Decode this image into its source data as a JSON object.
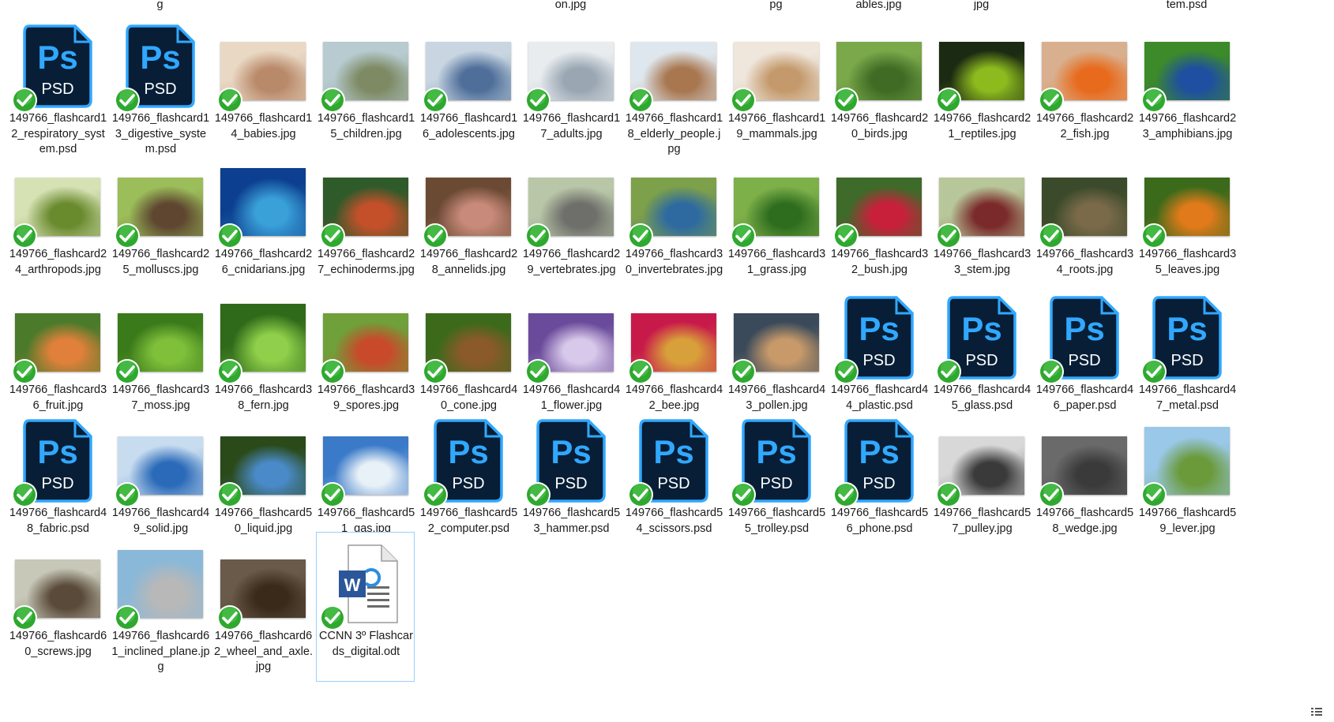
{
  "top_row_labels": [
    {
      "col": 1,
      "text": "g"
    },
    {
      "col": 5,
      "text": "on.jpg"
    },
    {
      "col": 7,
      "text": "pg"
    },
    {
      "col": 8,
      "text": "ables.jpg"
    },
    {
      "col": 9,
      "text": "jpg"
    },
    {
      "col": 11,
      "text": "tem.psd"
    }
  ],
  "files": [
    {
      "name": "149766_flashcard12_respiratory_system.psd",
      "type": "psd",
      "row": 0,
      "col": 0
    },
    {
      "name": "149766_flashcard13_digestive_system.psd",
      "type": "psd",
      "row": 0,
      "col": 1
    },
    {
      "name": "149766_flashcard14_babies.jpg",
      "type": "jpg",
      "row": 0,
      "col": 2,
      "colors": [
        "#e9d8c4",
        "#b98a6a"
      ]
    },
    {
      "name": "149766_flashcard15_children.jpg",
      "type": "jpg",
      "row": 0,
      "col": 3,
      "colors": [
        "#b7cbd0",
        "#7d8a63"
      ]
    },
    {
      "name": "149766_flashcard16_adolescents.jpg",
      "type": "jpg",
      "row": 0,
      "col": 4,
      "colors": [
        "#c9d6e2",
        "#4f6f9a"
      ]
    },
    {
      "name": "149766_flashcard17_adults.jpg",
      "type": "jpg",
      "row": 0,
      "col": 5,
      "colors": [
        "#e8ecef",
        "#9aa7b3"
      ]
    },
    {
      "name": "149766_flashcard18_elderly_people.jpg",
      "type": "jpg",
      "row": 0,
      "col": 6,
      "colors": [
        "#dfe7ee",
        "#a8764f"
      ]
    },
    {
      "name": "149766_flashcard19_mammals.jpg",
      "type": "jpg",
      "row": 0,
      "col": 7,
      "colors": [
        "#efe6dc",
        "#c49a6c"
      ]
    },
    {
      "name": "149766_flashcard20_birds.jpg",
      "type": "jpg",
      "row": 0,
      "col": 8,
      "colors": [
        "#7aa84a",
        "#3f6b24"
      ]
    },
    {
      "name": "149766_flashcard21_reptiles.jpg",
      "type": "jpg",
      "row": 0,
      "col": 9,
      "colors": [
        "#1b2a12",
        "#8dbb1e"
      ]
    },
    {
      "name": "149766_flashcard22_fish.jpg",
      "type": "jpg",
      "row": 0,
      "col": 10,
      "colors": [
        "#d9b08f",
        "#e86a1c"
      ]
    },
    {
      "name": "149766_flashcard23_amphibians.jpg",
      "type": "jpg",
      "row": 0,
      "col": 11,
      "colors": [
        "#3c8a2a",
        "#1f4fa0"
      ]
    },
    {
      "name": "149766_flashcard24_arthropods.jpg",
      "type": "jpg",
      "row": 1,
      "col": 0,
      "colors": [
        "#d6e2b4",
        "#6a8a2e"
      ]
    },
    {
      "name": "149766_flashcard25_molluscs.jpg",
      "type": "jpg",
      "row": 1,
      "col": 1,
      "colors": [
        "#9bbd5a",
        "#5e4630"
      ]
    },
    {
      "name": "149766_flashcard26_cnidarians.jpg",
      "type": "jpg",
      "row": 1,
      "col": 2,
      "colors": [
        "#0c3f8f",
        "#3aa0d8"
      ],
      "tall": true
    },
    {
      "name": "149766_flashcard27_echinoderms.jpg",
      "type": "jpg",
      "row": 1,
      "col": 3,
      "colors": [
        "#2f5a2a",
        "#c4502a"
      ]
    },
    {
      "name": "149766_flashcard28_annelids.jpg",
      "type": "jpg",
      "row": 1,
      "col": 4,
      "colors": [
        "#6b4a34",
        "#c88a7a"
      ]
    },
    {
      "name": "149766_flashcard29_vertebrates.jpg",
      "type": "jpg",
      "row": 1,
      "col": 5,
      "colors": [
        "#b9c7a8",
        "#6e6e6a"
      ]
    },
    {
      "name": "149766_flashcard30_invertebrates.jpg",
      "type": "jpg",
      "row": 1,
      "col": 6,
      "colors": [
        "#7da04a",
        "#2e6aa0"
      ]
    },
    {
      "name": "149766_flashcard31_grass.jpg",
      "type": "jpg",
      "row": 1,
      "col": 7,
      "colors": [
        "#7eb04a",
        "#2f6d1e"
      ]
    },
    {
      "name": "149766_flashcard32_bush.jpg",
      "type": "jpg",
      "row": 1,
      "col": 8,
      "colors": [
        "#3e6a2a",
        "#c8203a"
      ]
    },
    {
      "name": "149766_flashcard33_stem.jpg",
      "type": "jpg",
      "row": 1,
      "col": 9,
      "colors": [
        "#b8c79a",
        "#7a2a2a"
      ]
    },
    {
      "name": "149766_flashcard34_roots.jpg",
      "type": "jpg",
      "row": 1,
      "col": 10,
      "colors": [
        "#3a4a2a",
        "#7a6a4a"
      ]
    },
    {
      "name": "149766_flashcard35_leaves.jpg",
      "type": "jpg",
      "row": 1,
      "col": 11,
      "colors": [
        "#3a6a1a",
        "#e07a1a"
      ]
    },
    {
      "name": "149766_flashcard36_fruit.jpg",
      "type": "jpg",
      "row": 2,
      "col": 0,
      "colors": [
        "#4a7a2a",
        "#e0803a"
      ]
    },
    {
      "name": "149766_flashcard37_moss.jpg",
      "type": "jpg",
      "row": 2,
      "col": 1,
      "colors": [
        "#3a7a1a",
        "#7fbf3a"
      ]
    },
    {
      "name": "149766_flashcard38_fern.jpg",
      "type": "jpg",
      "row": 2,
      "col": 2,
      "colors": [
        "#2f6a1a",
        "#8fcf4a"
      ],
      "tall": true
    },
    {
      "name": "149766_flashcard39_spores.jpg",
      "type": "jpg",
      "row": 2,
      "col": 3,
      "colors": [
        "#6fa03a",
        "#c84a2a"
      ]
    },
    {
      "name": "149766_flashcard40_cone.jpg",
      "type": "jpg",
      "row": 2,
      "col": 4,
      "colors": [
        "#3a6a1a",
        "#8a5a2a"
      ]
    },
    {
      "name": "149766_flashcard41_flower.jpg",
      "type": "jpg",
      "row": 2,
      "col": 5,
      "colors": [
        "#6a4a9a",
        "#d8c8ea"
      ]
    },
    {
      "name": "149766_flashcard42_bee.jpg",
      "type": "jpg",
      "row": 2,
      "col": 6,
      "colors": [
        "#c81a4a",
        "#d8a03a"
      ]
    },
    {
      "name": "149766_flashcard43_pollen.jpg",
      "type": "jpg",
      "row": 2,
      "col": 7,
      "colors": [
        "#3a4a5a",
        "#c89a6a"
      ]
    },
    {
      "name": "149766_flashcard44_plastic.psd",
      "type": "psd",
      "row": 2,
      "col": 8
    },
    {
      "name": "149766_flashcard45_glass.psd",
      "type": "psd",
      "row": 2,
      "col": 9
    },
    {
      "name": "149766_flashcard46_paper.psd",
      "type": "psd",
      "row": 2,
      "col": 10
    },
    {
      "name": "149766_flashcard47_metal.psd",
      "type": "psd",
      "row": 2,
      "col": 11
    },
    {
      "name": "149766_flashcard48_fabric.psd",
      "type": "psd",
      "row": 3,
      "col": 0
    },
    {
      "name": "149766_flashcard49_solid.jpg",
      "type": "jpg",
      "row": 3,
      "col": 1,
      "colors": [
        "#c8dcf0",
        "#2a6ab8"
      ]
    },
    {
      "name": "149766_flashcard50_liquid.jpg",
      "type": "jpg",
      "row": 3,
      "col": 2,
      "colors": [
        "#2a4a1a",
        "#4a8ac8"
      ]
    },
    {
      "name": "149766_flashcard51_gas.jpg",
      "type": "jpg",
      "row": 3,
      "col": 3,
      "colors": [
        "#3a7ac8",
        "#e8f0f8"
      ]
    },
    {
      "name": "149766_flashcard52_computer.psd",
      "type": "psd",
      "row": 3,
      "col": 4
    },
    {
      "name": "149766_flashcard53_hammer.psd",
      "type": "psd",
      "row": 3,
      "col": 5
    },
    {
      "name": "149766_flashcard54_scissors.psd",
      "type": "psd",
      "row": 3,
      "col": 6
    },
    {
      "name": "149766_flashcard55_trolley.psd",
      "type": "psd",
      "row": 3,
      "col": 7
    },
    {
      "name": "149766_flashcard56_phone.psd",
      "type": "psd",
      "row": 3,
      "col": 8
    },
    {
      "name": "149766_flashcard57_pulley.jpg",
      "type": "jpg",
      "row": 3,
      "col": 9,
      "colors": [
        "#d8d8d8",
        "#3a3a3a"
      ]
    },
    {
      "name": "149766_flashcard58_wedge.jpg",
      "type": "jpg",
      "row": 3,
      "col": 10,
      "colors": [
        "#6a6a6a",
        "#3a3a3a"
      ]
    },
    {
      "name": "149766_flashcard59_lever.jpg",
      "type": "jpg",
      "row": 3,
      "col": 11,
      "colors": [
        "#9ac8e8",
        "#6a9a3a"
      ],
      "tall": true
    },
    {
      "name": "149766_flashcard60_screws.jpg",
      "type": "jpg",
      "row": 4,
      "col": 0,
      "colors": [
        "#c8c8b8",
        "#5a4a3a"
      ]
    },
    {
      "name": "149766_flashcard61_inclined_plane.jpg",
      "type": "jpg",
      "row": 4,
      "col": 1,
      "colors": [
        "#8ab8d8",
        "#b8b8b8"
      ],
      "tall": true
    },
    {
      "name": "149766_flashcard62_wheel_and_axle.jpg",
      "type": "jpg",
      "row": 4,
      "col": 2,
      "colors": [
        "#6a5a4a",
        "#3a2a1a"
      ]
    },
    {
      "name": "CCNN 3º Flashcards_digital.odt",
      "type": "odt",
      "row": 4,
      "col": 3,
      "selected": true
    }
  ],
  "colors": {
    "psd_bg": "#071e36",
    "psd_border": "#31a8ff",
    "check_green": "#2fa82f",
    "selection_border": "#99d1ff",
    "word_blue": "#2b579a"
  },
  "icons": {
    "psd": "photoshop-psd-icon",
    "odt": "word-document-icon",
    "sync": "sync-check-icon"
  }
}
